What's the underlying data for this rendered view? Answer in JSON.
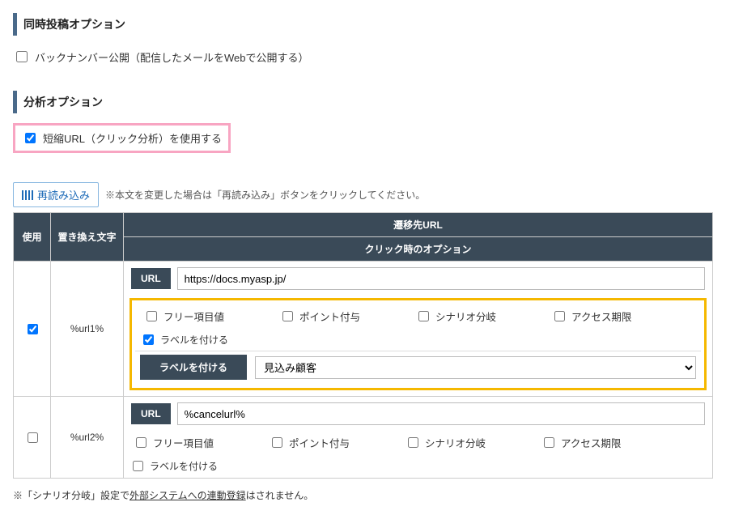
{
  "sections": {
    "simultaneous_post": {
      "title": "同時投稿オプション",
      "backnumber_label": "バックナンバー公開（配信したメールをWebで公開する）",
      "backnumber_checked": false
    },
    "analysis": {
      "title": "分析オプション",
      "short_url_label": "短縮URL（クリック分析）を使用する",
      "short_url_checked": true
    }
  },
  "reload": {
    "button_label": "再読み込み",
    "note": "※本文を変更した場合は「再読み込み」ボタンをクリックしてください。"
  },
  "table": {
    "headers": {
      "use": "使用",
      "replace": "置き換え文字",
      "dest_url": "遷移先URL",
      "click_option": "クリック時のオプション"
    },
    "url_label": "URL",
    "option_labels": {
      "free_item": "フリー項目値",
      "point": "ポイント付与",
      "scenario": "シナリオ分岐",
      "access_limit": "アクセス期限",
      "attach_label": "ラベルを付ける"
    },
    "label_section": {
      "title": "ラベルを付ける",
      "selected": "見込み顧客"
    },
    "rows": [
      {
        "use_checked": true,
        "replace_text": "%url1%",
        "url_value": "https://docs.myasp.jp/",
        "options": {
          "free_item": false,
          "point": false,
          "scenario": false,
          "access_limit": false,
          "attach_label": true
        },
        "show_label_section": true
      },
      {
        "use_checked": false,
        "replace_text": "%url2%",
        "url_value": "%cancelurl%",
        "options": {
          "free_item": false,
          "point": false,
          "scenario": false,
          "access_limit": false,
          "attach_label": false
        },
        "show_label_section": false
      }
    ]
  },
  "footer": {
    "prefix": "※「シナリオ分岐」設定で",
    "link_text": "外部システムへの連動登録",
    "suffix": "はされません。"
  }
}
